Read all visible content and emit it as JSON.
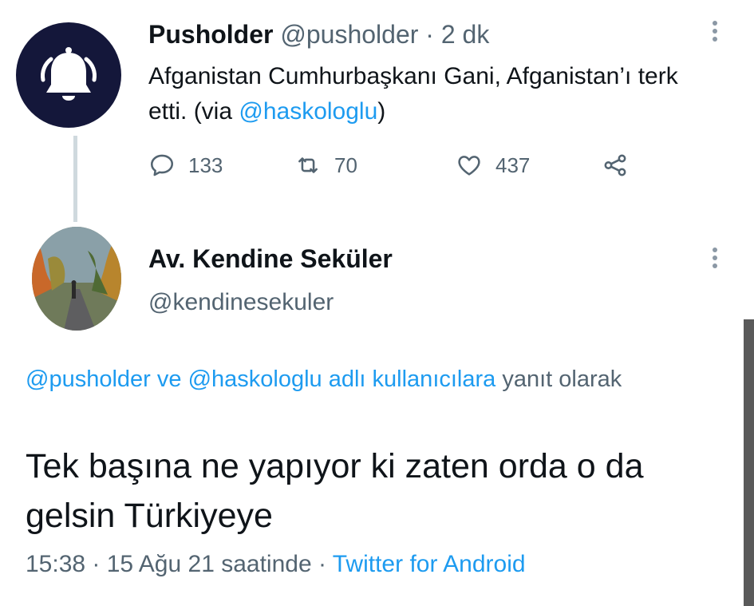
{
  "tweet1": {
    "name": "Pusholder",
    "handle": "@pusholder",
    "separator": "·",
    "time": "2 dk",
    "text_prefix": "Afganistan Cumhurbaşkanı Gani, Afganistan’ı terk etti. (via ",
    "text_mention": "@haskologlu",
    "text_suffix": ")",
    "avatar_icon": "bell-icon",
    "actions": {
      "replies": "133",
      "retweets": "70",
      "likes": "437"
    }
  },
  "tweet2": {
    "name": "Av. Kendine Seküler",
    "handle": "@kendinesekuler",
    "reply_mention1": "@pusholder",
    "reply_and": " ve ",
    "reply_mention2": "@haskologlu",
    "reply_link_suffix": " adlı kullanıcılara",
    "reply_suffix": " yanıt olarak",
    "body": "Tek başına ne yapıyor ki zaten orda o da gelsin Türkiyeye",
    "time": "15:38",
    "sep1": " · ",
    "date": "15 Ağu 21 saatinde",
    "sep2": " · ",
    "client": "Twitter for Android"
  },
  "colors": {
    "link": "#1d9bf0",
    "secondary_text": "#536471",
    "avatar_bg": "#14173a",
    "thread_line": "#cfd9de"
  }
}
